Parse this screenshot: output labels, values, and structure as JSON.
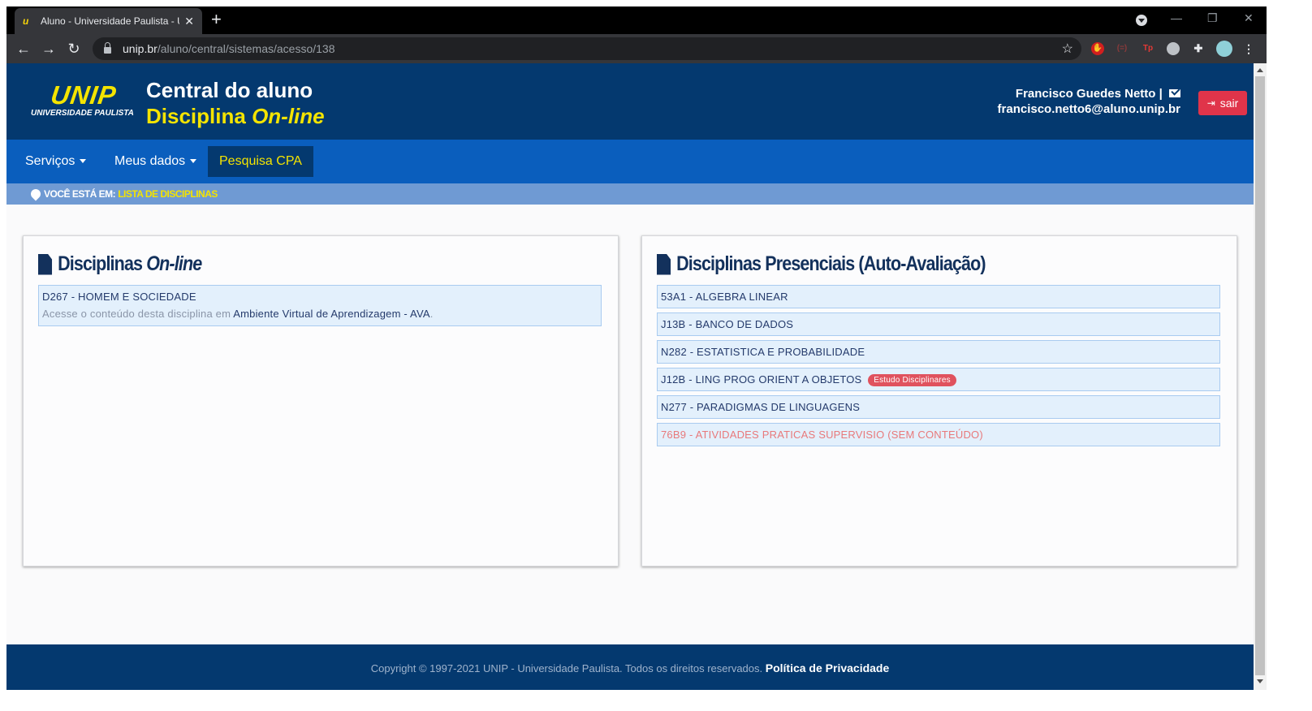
{
  "browser": {
    "tab_title": "Aluno - Universidade Paulista - U",
    "url_host": "unip.br",
    "url_path": "/aluno/central/sistemas/acesso/138"
  },
  "header": {
    "logo_text": "UNIP",
    "logo_sub": "UNIVERSIDADE PAULISTA",
    "title": "Central do aluno",
    "subtitle_main": "Disciplina",
    "subtitle_italic": "On-line",
    "user_name": "Francisco Guedes Netto",
    "user_separator": "|",
    "user_email": "francisco.netto6@aluno.unip.br",
    "logout_label": "sair"
  },
  "nav": {
    "items": [
      {
        "label": "Serviços"
      },
      {
        "label": "Meus dados"
      },
      {
        "label": "Pesquisa CPA"
      }
    ]
  },
  "breadcrumb": {
    "label": "VOCÊ ESTÁ EM:",
    "current": "LISTA DE DISCIPLINAS"
  },
  "online_panel": {
    "title_main": "Disciplinas",
    "title_italic": "On-line",
    "items": [
      {
        "label": "D267 - HOMEM E SOCIEDADE",
        "sub_prefix": "Acesse o conteúdo desta disciplina em",
        "sub_link": "Ambiente Virtual de Aprendizagem - AVA",
        "sub_suffix": "."
      }
    ]
  },
  "presencial_panel": {
    "title": "Disciplinas Presenciais (Auto-Avaliação)",
    "items": [
      {
        "label": "53A1 - ALGEBRA LINEAR"
      },
      {
        "label": "J13B - BANCO DE DADOS"
      },
      {
        "label": "N282 - ESTATISTICA E PROBABILIDADE"
      },
      {
        "label": "J12B - LING PROG ORIENT A OBJETOS",
        "badge": "Estudo Disciplinares"
      },
      {
        "label": "N277 - PARADIGMAS DE LINGUAGENS"
      },
      {
        "label": "76B9 - ATIVIDADES PRATICAS SUPERVISIO (SEM CONTEÚDO)"
      }
    ]
  },
  "footer": {
    "copyright": "Copyright © 1997-2021 UNIP - Universidade Paulista. Todos os direitos reservados.",
    "privacy_link": "Política de Privacidade"
  },
  "colors": {
    "header_bg": "#04396f",
    "nav_bg": "#0a5ebd",
    "accent_yellow": "#f4e400",
    "logout_red": "#e0344a",
    "item_bg": "#e3f0fc"
  }
}
